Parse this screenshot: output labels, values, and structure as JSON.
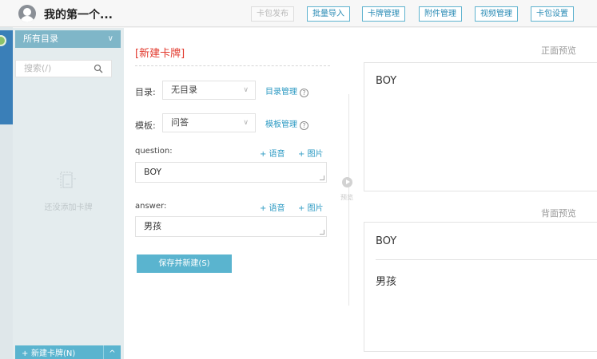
{
  "header": {
    "deck_title": "我的第一个...",
    "buttons": [
      "卡包发布",
      "批量导入",
      "卡牌管理",
      "附件管理",
      "视频管理",
      "卡包设置"
    ]
  },
  "sidebar": {
    "directory_select": "所有目录",
    "search_placeholder": "搜索(/)",
    "empty_text": "还没添加卡牌",
    "new_card_label": "新建卡牌(N)"
  },
  "form": {
    "title": "[新建卡牌]",
    "directory_label": "目录:",
    "directory_value": "无目录",
    "directory_manage": "目录管理",
    "template_label": "模板:",
    "template_value": "问答",
    "template_manage": "模板管理",
    "question_label": "question:",
    "question_value": "BOY",
    "answer_label": "answer:",
    "answer_value": "男孩",
    "add_audio": "+ 语音",
    "add_image": "+ 图片",
    "save_button": "保存并新建(S)",
    "preview_label": "预览"
  },
  "preview": {
    "front_label": "正面预览",
    "front_text": "BOY",
    "back_label": "背面预览",
    "back_question": "BOY",
    "back_answer": "男孩"
  },
  "colors": {
    "accent": "#5ab4cf",
    "link": "#2c9ac3",
    "title_red": "#e23a2e"
  }
}
